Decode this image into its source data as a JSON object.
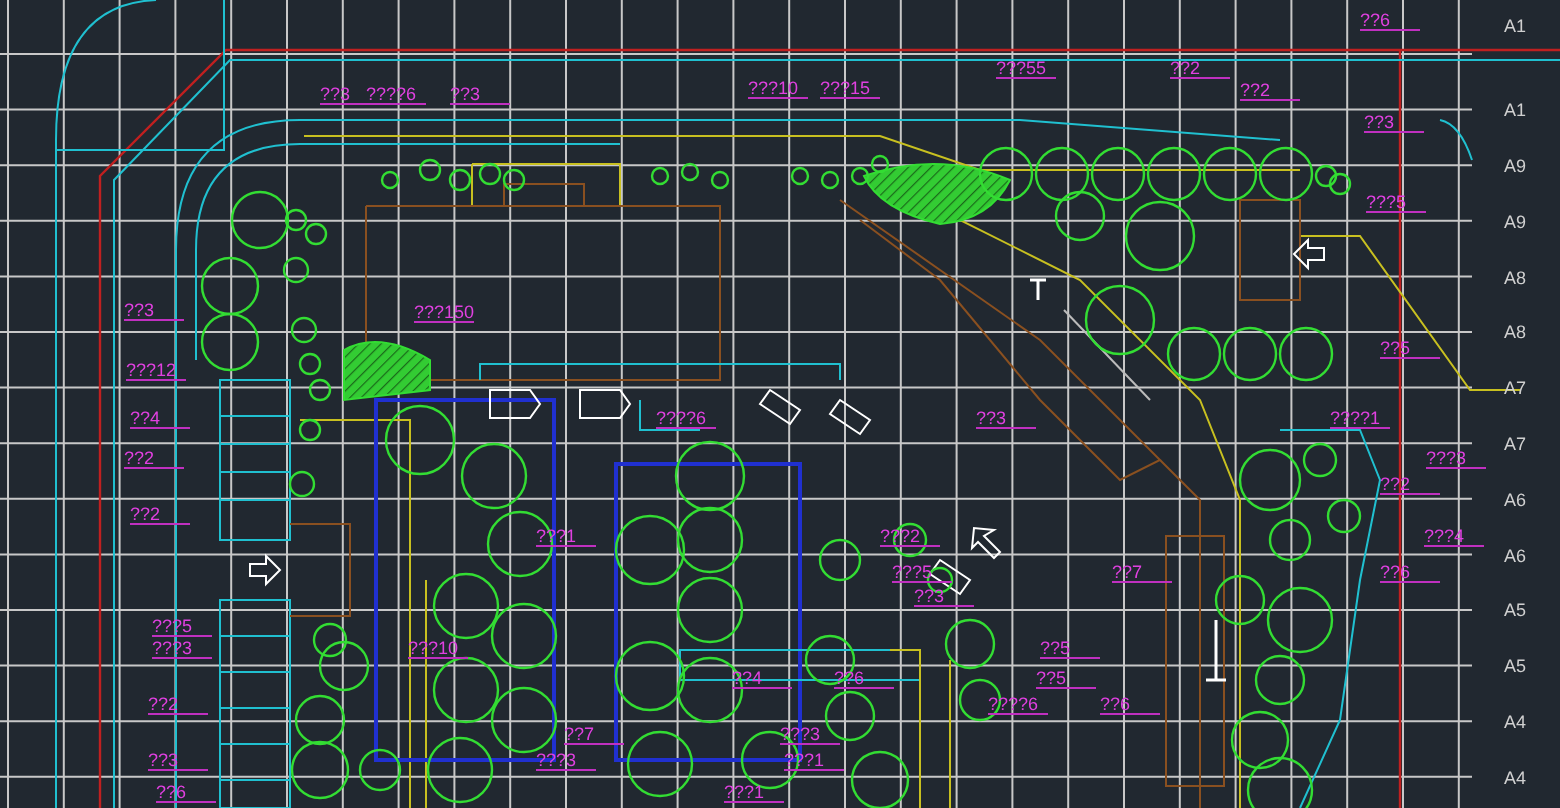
{
  "drawing": {
    "annotations": [
      {
        "text": "??6"
      },
      {
        "text": "???55"
      },
      {
        "text": "??2"
      },
      {
        "text": "??3"
      },
      {
        "text": "????6"
      },
      {
        "text": "??3"
      },
      {
        "text": "???10"
      },
      {
        "text": "???15"
      },
      {
        "text": "??2"
      },
      {
        "text": "??3"
      },
      {
        "text": "???5"
      },
      {
        "text": "??3"
      },
      {
        "text": "???150"
      },
      {
        "text": "??5"
      },
      {
        "text": "???12"
      },
      {
        "text": "??4"
      },
      {
        "text": "????6"
      },
      {
        "text": "??3"
      },
      {
        "text": "????1"
      },
      {
        "text": "??2"
      },
      {
        "text": "???3"
      },
      {
        "text": "??2"
      },
      {
        "text": "??2"
      },
      {
        "text": "???1"
      },
      {
        "text": "???2"
      },
      {
        "text": "???4"
      },
      {
        "text": "???5"
      },
      {
        "text": "??7"
      },
      {
        "text": "??6"
      },
      {
        "text": "??3"
      },
      {
        "text": "???5"
      },
      {
        "text": "???3"
      },
      {
        "text": "???10"
      },
      {
        "text": "??5"
      },
      {
        "text": "??4"
      },
      {
        "text": "??6"
      },
      {
        "text": "??5"
      },
      {
        "text": "??2"
      },
      {
        "text": "????6"
      },
      {
        "text": "??6"
      },
      {
        "text": "??7"
      },
      {
        "text": "???3"
      },
      {
        "text": "??3"
      },
      {
        "text": "???3"
      },
      {
        "text": "???1"
      },
      {
        "text": "??6"
      },
      {
        "text": "???1"
      }
    ],
    "axis_labels": [
      "A1",
      "A1",
      "A9",
      "A9",
      "A8",
      "A8",
      "A7",
      "A7",
      "A6",
      "A6",
      "A5",
      "A5",
      "A4",
      "A4"
    ]
  }
}
